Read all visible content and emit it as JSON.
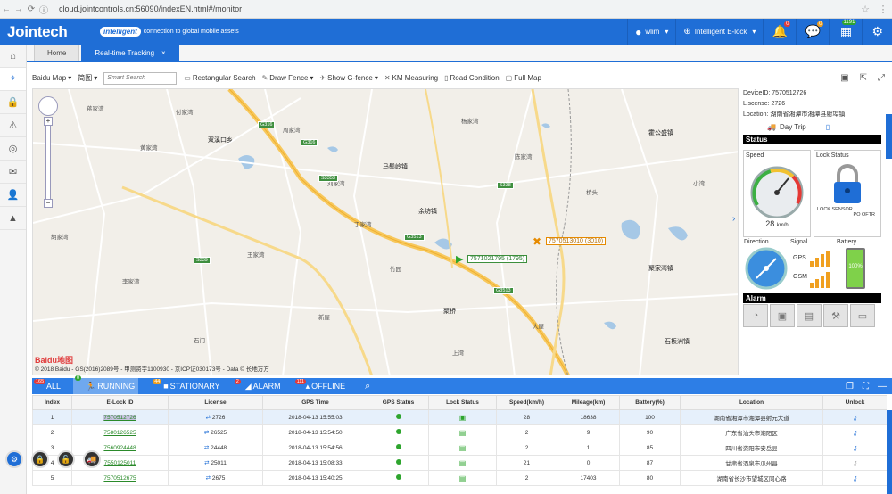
{
  "browser": {
    "url": "cloud.jointcontrols.cn:56090/indexEN.html#/monitor"
  },
  "header": {
    "logo": "Jointech",
    "intelligent_badge": "intelligent",
    "intelligent_text": "connection to global mobile assets",
    "user": "wlim",
    "product": "Intelligent E-lock",
    "alert_count": "0",
    "message_count": "0",
    "calendar_count": "1191"
  },
  "tabs": [
    {
      "label": "Home"
    },
    {
      "label": "Real-time Tracking"
    }
  ],
  "maptoolbar": {
    "map_select": "Baidu Map",
    "map_type": "简图",
    "smart_search_placeholder": "Smart Search",
    "rect_search": "Rectangular Search",
    "draw_fence": "Draw Fence",
    "show_gfence": "Show G-fence",
    "km_measuring": "KM Measuring",
    "road_condition": "Road Condition",
    "full_map": "Full Map"
  },
  "map": {
    "towns": [
      "双溪口乡",
      "马鬃岭镇",
      "余坊镇",
      "霍公盛镇",
      "聚家湾镇",
      "石板洲镇",
      "聚桥"
    ],
    "villages": [
      "蒋家湾",
      "黄家湾",
      "付家湾",
      "周家湾",
      "刘家湾",
      "杨家湾",
      "陈家湾",
      "胡家湾",
      "丁家湾",
      "李家湾",
      "王家湾",
      "新屋",
      "竹园",
      "大屋",
      "石门",
      "桥头",
      "小湾",
      "上湾"
    ],
    "road_shields": [
      "G316",
      "G316",
      "S3353",
      "G3513",
      "G3513",
      "S339",
      "S338"
    ],
    "vehicle_1": "7571021795 (1795)",
    "vehicle_2": "7570513010 (3010)",
    "copyright": "© 2018 Baidu - GS(2016)2089号 - 甲测资字1100930 - 京ICP证030173号 - Data © 长地万方",
    "map_logo_a": "Bai",
    "map_logo_b": "du地图"
  },
  "info": {
    "device_id": "DeviceID: 7570512726",
    "license": "Liscense: 2726",
    "location": "Location: 湖南省湘潭市湘潭县射埠镇",
    "day_trip": "Day Trip",
    "status_title": "Status",
    "speed_label": "Speed",
    "speed_value": "28",
    "speed_unit": "km/h",
    "lock_status_label": "Lock Status",
    "lock_sensor": "LOCK SENSOR",
    "lock_state": "PO OFTR",
    "direction_label": "Direction",
    "signal_label": "Signal",
    "battery_label": "Battery",
    "gps_label": "GPS",
    "gsm_label": "GSM",
    "battery_value": "100%",
    "alarm_title": "Alarm"
  },
  "filters": [
    {
      "label": "ALL",
      "count": "165"
    },
    {
      "label": "RUNNING",
      "count": "0"
    },
    {
      "label": "STATIONARY",
      "count": "44"
    },
    {
      "label": "ALARM",
      "count": "2"
    },
    {
      "label": "OFFLINE",
      "count": "111"
    }
  ],
  "table": {
    "headers": [
      "Index",
      "E-Lock ID",
      "License",
      "GPS Time",
      "GPS Status",
      "Lock Status",
      "Speed(km/h)",
      "Mileage(km)",
      "Battery(%)",
      "Location",
      "Unlock"
    ],
    "rows": [
      [
        "1",
        "7570512726",
        "2726",
        "2018-04-13 15:55:03",
        "",
        "",
        "28",
        "18638",
        "100",
        "湖南省湘潭市湘潭县射元大道"
      ],
      [
        "2",
        "7580126525",
        "26525",
        "2018-04-13 15:54:50",
        "",
        "",
        "2",
        "9",
        "90",
        "广东省汕头市潮阳区"
      ],
      [
        "3",
        "7560924448",
        "24448",
        "2018-04-13 15:54:56",
        "",
        "",
        "2",
        "1",
        "85",
        "四川省资阳市安岳县"
      ],
      [
        "4",
        "7550125011",
        "25011",
        "2018-04-13 15:08:33",
        "",
        "",
        "21",
        "0",
        "87",
        "甘肃省酒泉市瓜州县"
      ],
      [
        "5",
        "7570512675",
        "2675",
        "2018-04-13 15:40:25",
        "",
        "",
        "2",
        "17403",
        "80",
        "湖南省长沙市望城区同心路"
      ]
    ]
  }
}
